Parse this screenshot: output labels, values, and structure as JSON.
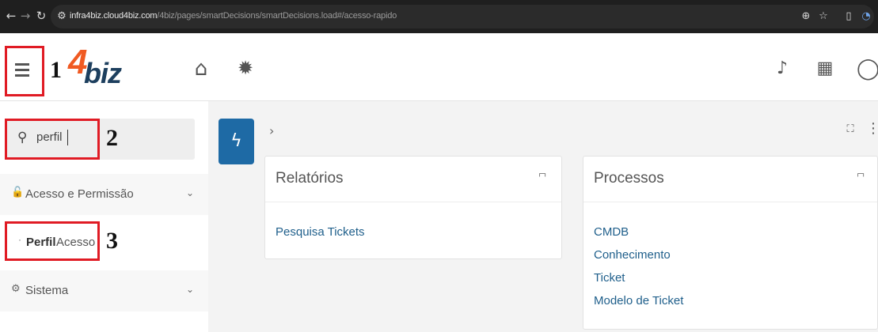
{
  "browser": {
    "url_host": "infra4biz.cloud4biz.com",
    "url_path": "/4biz/pages/smartDecisions/smartDecisions.load#/acesso-rapido"
  },
  "annotations": {
    "step1": "1",
    "step2": "2",
    "step3": "3"
  },
  "logo": {
    "four": "4",
    "biz": "biz"
  },
  "search": {
    "value": "perfil"
  },
  "sidebar": {
    "groups": [
      {
        "label": "Acesso e Permissão",
        "icon": "lock-icon"
      },
      {
        "label": "Sistema",
        "icon": "gears-icon"
      }
    ],
    "result": {
      "bold": "Perfil",
      "rest": "Acesso"
    }
  },
  "panels": [
    {
      "title": "Relatórios",
      "links": [
        "Pesquisa Tickets"
      ]
    },
    {
      "title": "Processos",
      "links": [
        "CMDB",
        "Conhecimento",
        "Ticket",
        "Modelo de Ticket"
      ]
    }
  ],
  "colors": {
    "accent": "#1e6aa5",
    "annotation_red": "#e01b24",
    "logo_orange": "#f05a22",
    "logo_navy": "#1d3f5e",
    "link": "#1f5f8b"
  }
}
